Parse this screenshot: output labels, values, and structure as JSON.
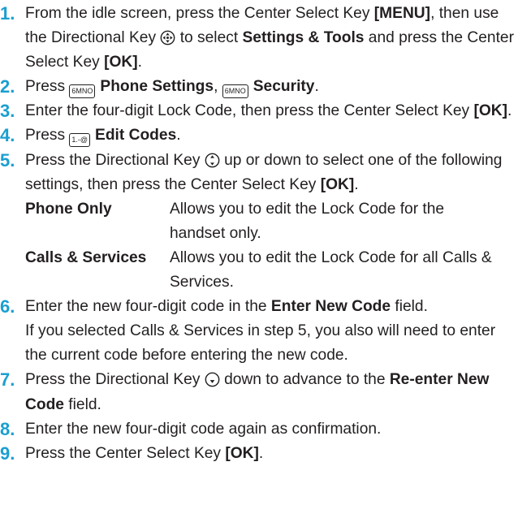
{
  "steps": [
    {
      "num": "1.",
      "t1": "From the idle screen, press the Center Select Key ",
      "b1": "[MENU]",
      "t2": ", then use the Directional Key ",
      "t3": " to select ",
      "b2": "Settings & Tools",
      "t4": " and press the Center Select Key ",
      "b3": "[OK]",
      "t5": "."
    },
    {
      "num": "2.",
      "t1": "Press ",
      "key1": "6MNO",
      "b1": "Phone Settings",
      "t2": ", ",
      "key2": "6MNO",
      "b2": "Security",
      "t3": "."
    },
    {
      "num": "3.",
      "t1": "Enter the four-digit Lock Code, then press the Center Select Key ",
      "b1": "[OK]",
      "t2": "."
    },
    {
      "num": "4.",
      "t1": "Press ",
      "key1": "1.-@",
      "b1": "Edit Codes",
      "t2": "."
    },
    {
      "num": "5.",
      "t1": "Press the Directional Key ",
      "t2": " up or down to select one of the following settings, then press the Center Select Key ",
      "b1": "[OK]",
      "t3": ".",
      "options": [
        {
          "name": "Phone Only",
          "desc": "Allows you to edit the Lock Code for the handset only."
        },
        {
          "name": "Calls & Services",
          "desc": "Allows you to edit the Lock Code for all Calls & Services."
        }
      ]
    },
    {
      "num": "6.",
      "t1": "Enter the new four-digit code in the ",
      "b1": "Enter New Code",
      "t2": " field.",
      "t3": "If you selected Calls & Services in step 5, you also will need to enter the current code before entering the new code."
    },
    {
      "num": "7.",
      "t1": "Press the Directional Key ",
      "t2": " down to advance to the ",
      "b1": "Re-enter New Code",
      "t3": " field."
    },
    {
      "num": "8.",
      "t1": "Enter the new four-digit code again as confirmation."
    },
    {
      "num": "9.",
      "t1": "Press the Center Select Key ",
      "b1": "[OK]",
      "t2": "."
    }
  ],
  "colors": {
    "step_number": "#1a9fd0",
    "text": "#231f20"
  },
  "icons": {
    "navigation": "directional-key-icon",
    "up_down": "directional-key-up-down-icon",
    "down": "directional-key-down-icon",
    "key": "keypad-key-icon"
  }
}
